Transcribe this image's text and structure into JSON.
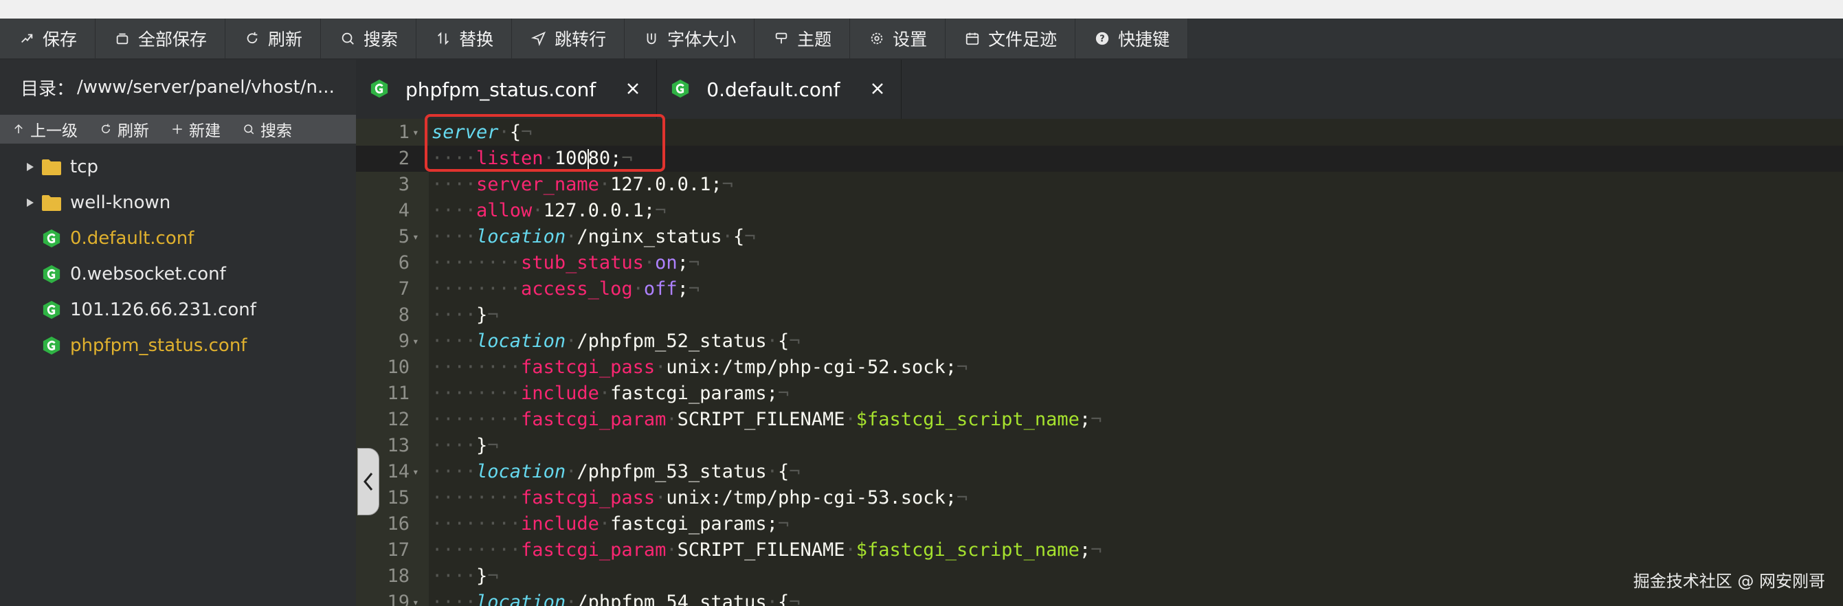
{
  "toolbar": {
    "buttons": [
      {
        "label": "保存",
        "icon": "save-icon"
      },
      {
        "label": "全部保存",
        "icon": "save-all-icon"
      },
      {
        "label": "刷新",
        "icon": "refresh-icon"
      },
      {
        "label": "搜索",
        "icon": "search-icon"
      },
      {
        "label": "替换",
        "icon": "replace-icon"
      },
      {
        "label": "跳转行",
        "icon": "goto-line-icon"
      },
      {
        "label": "字体大小",
        "icon": "font-size-icon"
      },
      {
        "label": "主题",
        "icon": "theme-icon"
      },
      {
        "label": "设置",
        "icon": "gear-icon"
      },
      {
        "label": "文件足迹",
        "icon": "calendar-icon"
      },
      {
        "label": "快捷键",
        "icon": "help-icon"
      }
    ]
  },
  "sidebar": {
    "dir_label": "目录：",
    "dir_path": "/www/server/panel/vhost/n...",
    "tools": [
      {
        "label": "上一级",
        "icon": "arrow-up-icon"
      },
      {
        "label": "刷新",
        "icon": "refresh-icon"
      },
      {
        "label": "新建",
        "icon": "plus-icon"
      },
      {
        "label": "搜索",
        "icon": "search-icon"
      }
    ],
    "tree": [
      {
        "name": "tcp",
        "type": "folder",
        "active": false
      },
      {
        "name": "well-known",
        "type": "folder",
        "active": false
      },
      {
        "name": "0.default.conf",
        "type": "file",
        "active": true
      },
      {
        "name": "0.websocket.conf",
        "type": "file",
        "active": false
      },
      {
        "name": "101.126.66.231.conf",
        "type": "file",
        "active": false
      },
      {
        "name": "phpfpm_status.conf",
        "type": "file",
        "active": true
      }
    ]
  },
  "tabs": [
    {
      "label": "phpfpm_status.conf",
      "active": true
    },
    {
      "label": "0.default.conf",
      "active": false
    }
  ],
  "editor": {
    "current_line": 2,
    "lines": [
      {
        "n": "1",
        "fold": true,
        "indent": 0,
        "tokens": [
          [
            "kw",
            "server"
          ],
          [
            "ws",
            "·"
          ],
          [
            "plain",
            "{"
          ],
          [
            "ws",
            "¬"
          ]
        ]
      },
      {
        "n": "2",
        "fold": false,
        "indent": 1,
        "tokens": [
          [
            "dir",
            "listen"
          ],
          [
            "ws",
            "·"
          ],
          [
            "plain",
            "100"
          ],
          [
            "cursor",
            ""
          ],
          [
            "plain",
            "80;"
          ],
          [
            "ws",
            "¬"
          ]
        ]
      },
      {
        "n": "3",
        "fold": false,
        "indent": 1,
        "tokens": [
          [
            "dir",
            "server_name"
          ],
          [
            "ws",
            "·"
          ],
          [
            "plain",
            "127.0.0.1;"
          ],
          [
            "ws",
            "¬"
          ]
        ]
      },
      {
        "n": "4",
        "fold": false,
        "indent": 1,
        "tokens": [
          [
            "dir",
            "allow"
          ],
          [
            "ws",
            "·"
          ],
          [
            "plain",
            "127.0.0.1;"
          ],
          [
            "ws",
            "¬"
          ]
        ]
      },
      {
        "n": "5",
        "fold": true,
        "indent": 1,
        "tokens": [
          [
            "kw",
            "location"
          ],
          [
            "ws",
            "·"
          ],
          [
            "plain",
            "/nginx_status"
          ],
          [
            "ws",
            "·"
          ],
          [
            "plain",
            "{"
          ],
          [
            "ws",
            "¬"
          ]
        ]
      },
      {
        "n": "6",
        "fold": false,
        "indent": 2,
        "tokens": [
          [
            "dir",
            "stub_status"
          ],
          [
            "ws",
            "·"
          ],
          [
            "on",
            "on"
          ],
          [
            "plain",
            ";"
          ],
          [
            "ws",
            "¬"
          ]
        ]
      },
      {
        "n": "7",
        "fold": false,
        "indent": 2,
        "tokens": [
          [
            "dir",
            "access_log"
          ],
          [
            "ws",
            "·"
          ],
          [
            "on",
            "off"
          ],
          [
            "plain",
            ";"
          ],
          [
            "ws",
            "¬"
          ]
        ]
      },
      {
        "n": "8",
        "fold": false,
        "indent": 1,
        "tokens": [
          [
            "plain",
            "}"
          ],
          [
            "ws",
            "¬"
          ]
        ]
      },
      {
        "n": "9",
        "fold": true,
        "indent": 1,
        "tokens": [
          [
            "kw",
            "location"
          ],
          [
            "ws",
            "·"
          ],
          [
            "plain",
            "/phpfpm_52_status"
          ],
          [
            "ws",
            "·"
          ],
          [
            "plain",
            "{"
          ],
          [
            "ws",
            "¬"
          ]
        ]
      },
      {
        "n": "10",
        "fold": false,
        "indent": 2,
        "tokens": [
          [
            "dir",
            "fastcgi_pass"
          ],
          [
            "ws",
            "·"
          ],
          [
            "plain",
            "unix:/tmp/php-cgi-52.sock;"
          ],
          [
            "ws",
            "¬"
          ]
        ]
      },
      {
        "n": "11",
        "fold": false,
        "indent": 2,
        "tokens": [
          [
            "dir",
            "include"
          ],
          [
            "ws",
            "·"
          ],
          [
            "plain",
            "fastcgi_params;"
          ],
          [
            "ws",
            "¬"
          ]
        ]
      },
      {
        "n": "12",
        "fold": false,
        "indent": 2,
        "tokens": [
          [
            "dir",
            "fastcgi_param"
          ],
          [
            "ws",
            "·"
          ],
          [
            "plain",
            "SCRIPT_FILENAME"
          ],
          [
            "ws",
            "·"
          ],
          [
            "var",
            "$fastcgi_script_name"
          ],
          [
            "plain",
            ";"
          ],
          [
            "ws",
            "¬"
          ]
        ]
      },
      {
        "n": "13",
        "fold": false,
        "indent": 1,
        "tokens": [
          [
            "plain",
            "}"
          ],
          [
            "ws",
            "¬"
          ]
        ]
      },
      {
        "n": "14",
        "fold": true,
        "indent": 1,
        "tokens": [
          [
            "kw",
            "location"
          ],
          [
            "ws",
            "·"
          ],
          [
            "plain",
            "/phpfpm_53_status"
          ],
          [
            "ws",
            "·"
          ],
          [
            "plain",
            "{"
          ],
          [
            "ws",
            "¬"
          ]
        ]
      },
      {
        "n": "15",
        "fold": false,
        "indent": 2,
        "tokens": [
          [
            "dir",
            "fastcgi_pass"
          ],
          [
            "ws",
            "·"
          ],
          [
            "plain",
            "unix:/tmp/php-cgi-53.sock;"
          ],
          [
            "ws",
            "¬"
          ]
        ]
      },
      {
        "n": "16",
        "fold": false,
        "indent": 2,
        "tokens": [
          [
            "dir",
            "include"
          ],
          [
            "ws",
            "·"
          ],
          [
            "plain",
            "fastcgi_params;"
          ],
          [
            "ws",
            "¬"
          ]
        ]
      },
      {
        "n": "17",
        "fold": false,
        "indent": 2,
        "tokens": [
          [
            "dir",
            "fastcgi_param"
          ],
          [
            "ws",
            "·"
          ],
          [
            "plain",
            "SCRIPT_FILENAME"
          ],
          [
            "ws",
            "·"
          ],
          [
            "var",
            "$fastcgi_script_name"
          ],
          [
            "plain",
            ";"
          ],
          [
            "ws",
            "¬"
          ]
        ]
      },
      {
        "n": "18",
        "fold": false,
        "indent": 1,
        "tokens": [
          [
            "plain",
            "}"
          ],
          [
            "ws",
            "¬"
          ]
        ]
      },
      {
        "n": "19",
        "fold": true,
        "indent": 1,
        "tokens": [
          [
            "kw",
            "location"
          ],
          [
            "ws",
            "·"
          ],
          [
            "plain",
            "/phpfpm_54_status"
          ],
          [
            "ws",
            "·"
          ],
          [
            "plain",
            "{"
          ],
          [
            "ws",
            "¬"
          ]
        ]
      }
    ]
  },
  "colors": {
    "accent_active_file": "#e0b12e",
    "file_icon_green": "#2fb344",
    "highlight_box": "#e0332e"
  },
  "watermark": "掘金技术社区 @ 网安刚哥"
}
